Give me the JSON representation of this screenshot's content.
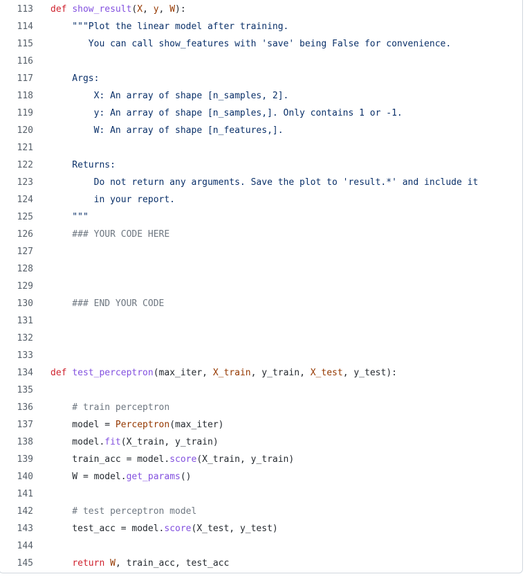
{
  "code_view": {
    "lines": [
      {
        "number": "113",
        "tokens": [
          {
            "t": "def ",
            "c": "kw"
          },
          {
            "t": "show_result",
            "c": "fn"
          },
          {
            "t": "(",
            "c": "plain"
          },
          {
            "t": "X",
            "c": "param"
          },
          {
            "t": ", ",
            "c": "plain"
          },
          {
            "t": "y",
            "c": "param"
          },
          {
            "t": ", ",
            "c": "plain"
          },
          {
            "t": "W",
            "c": "param"
          },
          {
            "t": "):",
            "c": "plain"
          }
        ]
      },
      {
        "number": "114",
        "tokens": [
          {
            "t": "    \"\"\"Plot the linear model after training.",
            "c": "doc"
          }
        ]
      },
      {
        "number": "115",
        "tokens": [
          {
            "t": "       You can call show_features with 'save' being False for convenience.",
            "c": "doc"
          }
        ]
      },
      {
        "number": "116",
        "tokens": []
      },
      {
        "number": "117",
        "tokens": [
          {
            "t": "    Args:",
            "c": "doc"
          }
        ]
      },
      {
        "number": "118",
        "tokens": [
          {
            "t": "        X: An array of shape [n_samples, 2].",
            "c": "doc"
          }
        ]
      },
      {
        "number": "119",
        "tokens": [
          {
            "t": "        y: An array of shape [n_samples,]. Only contains 1 or -1.",
            "c": "doc"
          }
        ]
      },
      {
        "number": "120",
        "tokens": [
          {
            "t": "        W: An array of shape [n_features,].",
            "c": "doc"
          }
        ]
      },
      {
        "number": "121",
        "tokens": []
      },
      {
        "number": "122",
        "tokens": [
          {
            "t": "    Returns:",
            "c": "doc"
          }
        ]
      },
      {
        "number": "123",
        "tokens": [
          {
            "t": "        Do not return any arguments. Save the plot to 'result.*' and include it",
            "c": "doc"
          }
        ]
      },
      {
        "number": "124",
        "tokens": [
          {
            "t": "        in your report.",
            "c": "doc"
          }
        ]
      },
      {
        "number": "125",
        "tokens": [
          {
            "t": "    \"\"\"",
            "c": "doc"
          }
        ]
      },
      {
        "number": "126",
        "tokens": [
          {
            "t": "    ### YOUR CODE HERE",
            "c": "cm"
          }
        ]
      },
      {
        "number": "127",
        "tokens": []
      },
      {
        "number": "128",
        "tokens": []
      },
      {
        "number": "129",
        "tokens": []
      },
      {
        "number": "130",
        "tokens": [
          {
            "t": "    ### END YOUR CODE",
            "c": "cm"
          }
        ]
      },
      {
        "number": "131",
        "tokens": []
      },
      {
        "number": "132",
        "tokens": []
      },
      {
        "number": "133",
        "tokens": []
      },
      {
        "number": "134",
        "tokens": [
          {
            "t": "def ",
            "c": "kw"
          },
          {
            "t": "test_perceptron",
            "c": "fn"
          },
          {
            "t": "(",
            "c": "plain"
          },
          {
            "t": "max_iter",
            "c": "plain"
          },
          {
            "t": ", ",
            "c": "plain"
          },
          {
            "t": "X_train",
            "c": "param"
          },
          {
            "t": ", ",
            "c": "plain"
          },
          {
            "t": "y_train",
            "c": "plain"
          },
          {
            "t": ", ",
            "c": "plain"
          },
          {
            "t": "X_test",
            "c": "param"
          },
          {
            "t": ", ",
            "c": "plain"
          },
          {
            "t": "y_test",
            "c": "plain"
          },
          {
            "t": "):",
            "c": "plain"
          }
        ]
      },
      {
        "number": "135",
        "tokens": []
      },
      {
        "number": "136",
        "tokens": [
          {
            "t": "    # train perceptron",
            "c": "cm"
          }
        ]
      },
      {
        "number": "137",
        "tokens": [
          {
            "t": "    model = ",
            "c": "plain"
          },
          {
            "t": "Perceptron",
            "c": "param"
          },
          {
            "t": "(max_iter)",
            "c": "plain"
          }
        ]
      },
      {
        "number": "138",
        "tokens": [
          {
            "t": "    model.",
            "c": "plain"
          },
          {
            "t": "fit",
            "c": "fn"
          },
          {
            "t": "(X_train, y_train)",
            "c": "plain"
          }
        ]
      },
      {
        "number": "139",
        "tokens": [
          {
            "t": "    train_acc = model.",
            "c": "plain"
          },
          {
            "t": "score",
            "c": "fn"
          },
          {
            "t": "(X_train, y_train)",
            "c": "plain"
          }
        ]
      },
      {
        "number": "140",
        "tokens": [
          {
            "t": "    W = model.",
            "c": "plain"
          },
          {
            "t": "get_params",
            "c": "fn"
          },
          {
            "t": "()",
            "c": "plain"
          }
        ]
      },
      {
        "number": "141",
        "tokens": []
      },
      {
        "number": "142",
        "tokens": [
          {
            "t": "    # test perceptron model",
            "c": "cm"
          }
        ]
      },
      {
        "number": "143",
        "tokens": [
          {
            "t": "    test_acc = model.",
            "c": "plain"
          },
          {
            "t": "score",
            "c": "fn"
          },
          {
            "t": "(X_test, y_test)",
            "c": "plain"
          }
        ]
      },
      {
        "number": "144",
        "tokens": []
      },
      {
        "number": "145",
        "tokens": [
          {
            "t": "    ",
            "c": "plain"
          },
          {
            "t": "return ",
            "c": "kw"
          },
          {
            "t": "W",
            "c": "param"
          },
          {
            "t": ", train_acc, test_acc",
            "c": "plain"
          }
        ]
      }
    ]
  }
}
